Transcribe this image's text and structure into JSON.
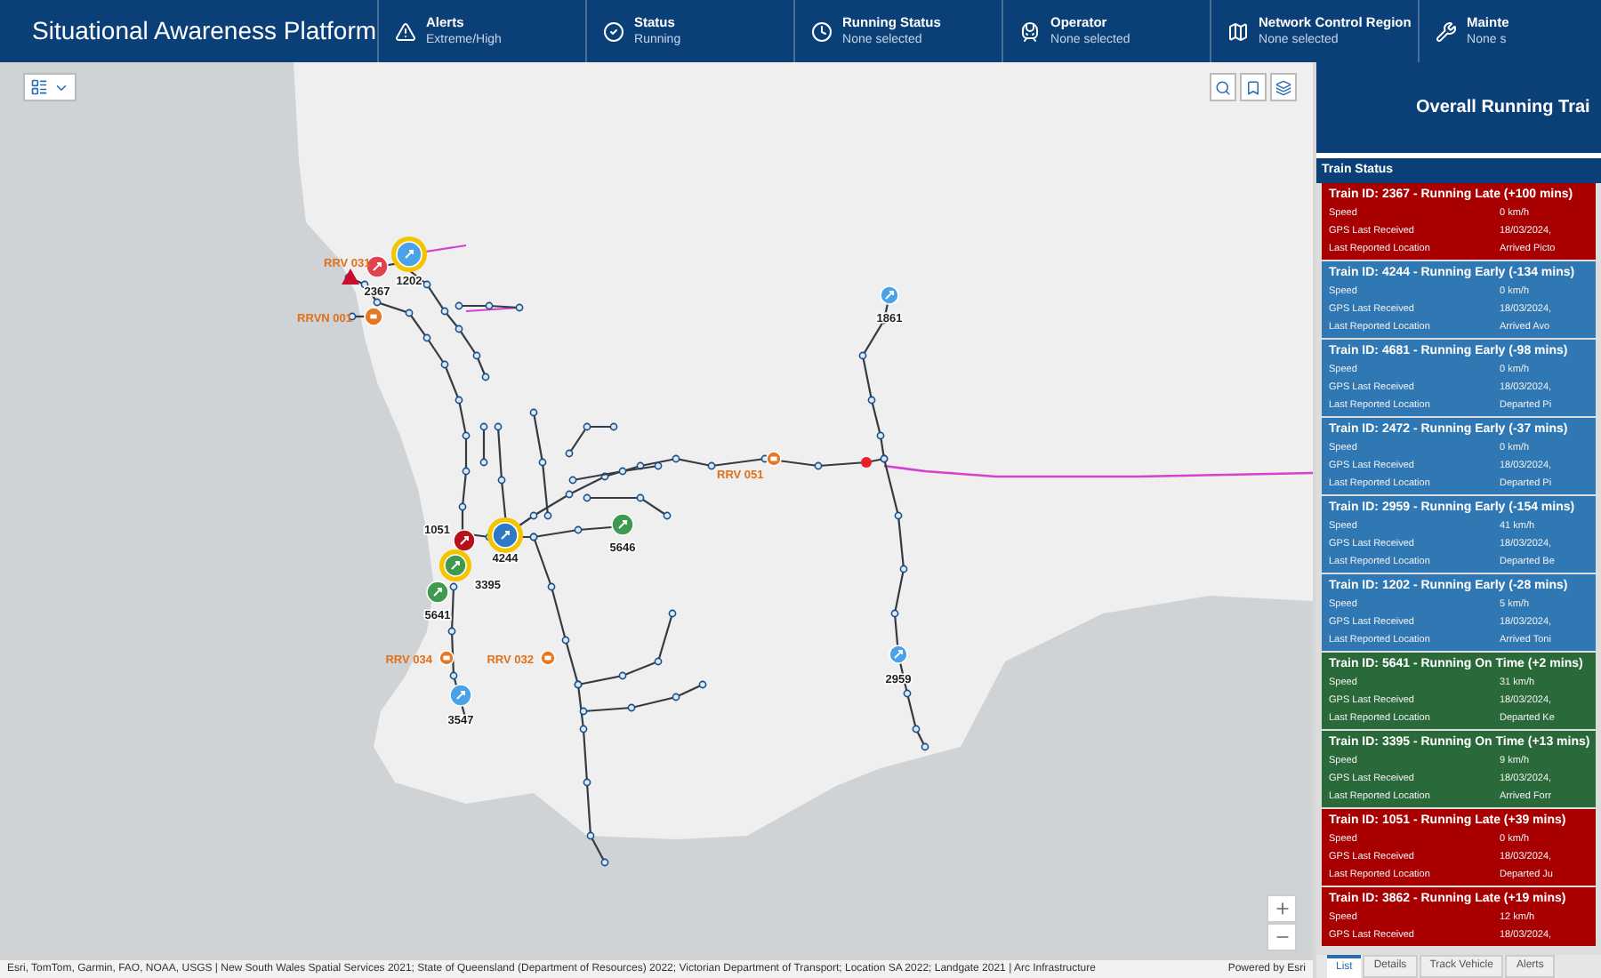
{
  "header": {
    "title": "Situational Awareness Platform",
    "filters": [
      {
        "kind": "alert",
        "label": "Alerts",
        "value": "Extreme/High"
      },
      {
        "kind": "status",
        "label": "Status",
        "value": "Running"
      },
      {
        "kind": "clock",
        "label": "Running Status",
        "value": "None selected"
      },
      {
        "kind": "train",
        "label": "Operator",
        "value": "None selected"
      },
      {
        "kind": "region",
        "label": "Network Control Region",
        "value": "None selected"
      },
      {
        "kind": "tools",
        "label": "Mainte",
        "value": "None s"
      }
    ]
  },
  "map": {
    "markers": [
      {
        "kind": "train",
        "label": "1202",
        "color": "#4aa3e8",
        "highlighted": true
      },
      {
        "kind": "train",
        "label": "2367",
        "color": "#e0424f",
        "highlighted": false
      },
      {
        "kind": "alert",
        "label": "RRV 031",
        "color": "#c8102e"
      },
      {
        "kind": "vehicle",
        "label": "RRVN 001",
        "color": "#e87722"
      },
      {
        "kind": "train",
        "label": "1861",
        "color": "#4aa3e8",
        "highlighted": false
      },
      {
        "kind": "vehicle",
        "label": "RRV 051",
        "color": "#e87722"
      },
      {
        "kind": "train",
        "label": "5646",
        "color": "#3f9a4f",
        "highlighted": false
      },
      {
        "kind": "train",
        "label": "4244",
        "color": "#2e78c8",
        "highlighted": true
      },
      {
        "kind": "train",
        "label": "1051",
        "color": "#b5121b",
        "highlighted": false
      },
      {
        "kind": "train",
        "label": "3395",
        "color": "#3f9a4f",
        "highlighted": true
      },
      {
        "kind": "train",
        "label": "5641",
        "color": "#3f9a4f",
        "highlighted": false
      },
      {
        "kind": "vehicle",
        "label": "RRV 034",
        "color": "#e87722"
      },
      {
        "kind": "vehicle",
        "label": "RRV 032",
        "color": "#e87722"
      },
      {
        "kind": "train",
        "label": "3547",
        "color": "#4aa3e8",
        "highlighted": false
      },
      {
        "kind": "train",
        "label": "2959",
        "color": "#4aa3e8",
        "highlighted": false
      }
    ],
    "attribution": "Esri, TomTom, Garmin, FAO, NOAA, USGS | New South Wales Spatial Services 2021; State of Queensland (Department of Resources) 2022; Victorian Department of Transport; Location SA 2022; Landgate 2021 | Arc Infrastructure",
    "powered_by": "Powered by Esri"
  },
  "panel": {
    "title": "Overall Running Trai",
    "list_title": "Train Status",
    "trains": [
      {
        "kind": "late",
        "title": "Train ID: 2367 - Running Late (+100 mins)",
        "fields": [
          {
            "label": "Speed",
            "value": "0 km/h"
          },
          {
            "label": "GPS Last Received",
            "value": "18/03/2024,"
          },
          {
            "label": "Last Reported Location",
            "value": "Arrived Picto"
          }
        ]
      },
      {
        "kind": "early",
        "title": "Train ID: 4244 - Running Early (-134 mins)",
        "fields": [
          {
            "label": "Speed",
            "value": "0 km/h"
          },
          {
            "label": "GPS Last Received",
            "value": "18/03/2024,"
          },
          {
            "label": "Last Reported Location",
            "value": "Arrived Avo"
          }
        ]
      },
      {
        "kind": "early",
        "title": "Train ID: 4681 - Running Early (-98 mins)",
        "fields": [
          {
            "label": "Speed",
            "value": "0 km/h"
          },
          {
            "label": "GPS Last Received",
            "value": "18/03/2024,"
          },
          {
            "label": "Last Reported Location",
            "value": "Departed Pi"
          }
        ]
      },
      {
        "kind": "early",
        "title": "Train ID: 2472 - Running Early (-37 mins)",
        "fields": [
          {
            "label": "Speed",
            "value": "0 km/h"
          },
          {
            "label": "GPS Last Received",
            "value": "18/03/2024,"
          },
          {
            "label": "Last Reported Location",
            "value": "Departed Pi"
          }
        ]
      },
      {
        "kind": "early",
        "title": "Train ID: 2959 - Running Early (-154 mins)",
        "fields": [
          {
            "label": "Speed",
            "value": "41 km/h"
          },
          {
            "label": "GPS Last Received",
            "value": "18/03/2024,"
          },
          {
            "label": "Last Reported Location",
            "value": "Departed Be"
          }
        ]
      },
      {
        "kind": "early",
        "title": "Train ID: 1202 - Running Early (-28 mins)",
        "fields": [
          {
            "label": "Speed",
            "value": "5 km/h"
          },
          {
            "label": "GPS Last Received",
            "value": "18/03/2024,"
          },
          {
            "label": "Last Reported Location",
            "value": "Arrived Toni"
          }
        ]
      },
      {
        "kind": "on_time",
        "title": "Train ID: 5641 - Running On Time (+2 mins)",
        "fields": [
          {
            "label": "Speed",
            "value": "31 km/h"
          },
          {
            "label": "GPS Last Received",
            "value": "18/03/2024,"
          },
          {
            "label": "Last Reported Location",
            "value": "Departed Ke"
          }
        ]
      },
      {
        "kind": "on_time",
        "title": "Train ID: 3395 - Running On Time (+13 mins)",
        "fields": [
          {
            "label": "Speed",
            "value": "9 km/h"
          },
          {
            "label": "GPS Last Received",
            "value": "18/03/2024,"
          },
          {
            "label": "Last Reported Location",
            "value": "Arrived Forr"
          }
        ]
      },
      {
        "kind": "late",
        "title": "Train ID: 1051 - Running Late (+39 mins)",
        "fields": [
          {
            "label": "Speed",
            "value": "0 km/h"
          },
          {
            "label": "GPS Last Received",
            "value": "18/03/2024,"
          },
          {
            "label": "Last Reported Location",
            "value": "Departed Ju"
          }
        ]
      },
      {
        "kind": "late",
        "title": "Train ID: 3862 - Running Late (+19 mins)",
        "fields": [
          {
            "label": "Speed",
            "value": "12 km/h"
          },
          {
            "label": "GPS Last Received",
            "value": "18/03/2024,"
          }
        ]
      }
    ],
    "tabs": [
      {
        "label": "List",
        "selected": true
      },
      {
        "label": "Details",
        "selected": false
      },
      {
        "label": "Track Vehicle",
        "selected": false
      },
      {
        "label": "Alerts",
        "selected": false
      }
    ]
  }
}
